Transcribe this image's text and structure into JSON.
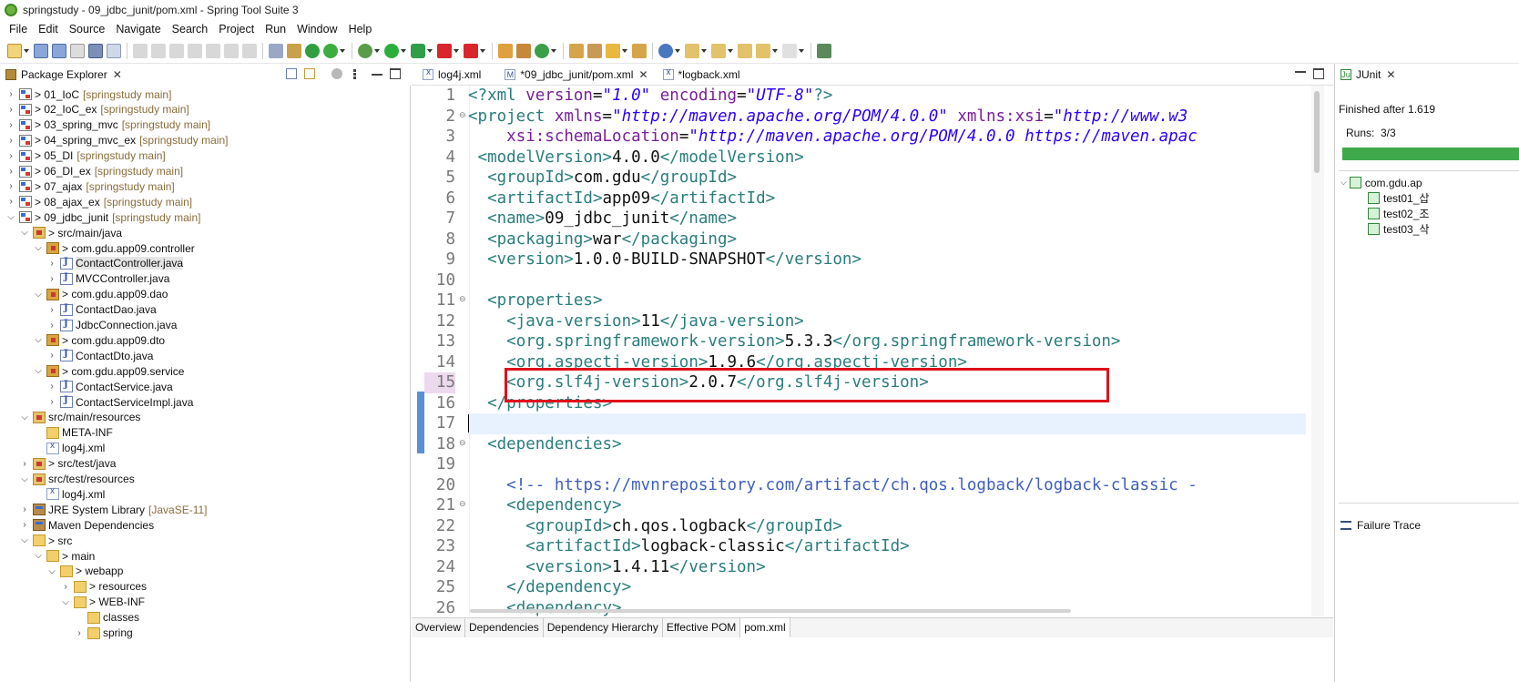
{
  "window": {
    "title": "springstudy - 09_jdbc_junit/pom.xml - Spring Tool Suite 3"
  },
  "menu": [
    "File",
    "Edit",
    "Source",
    "Navigate",
    "Search",
    "Project",
    "Run",
    "Window",
    "Help"
  ],
  "package_explorer": {
    "title": "Package Explorer",
    "tree": [
      {
        "label": "> 01_IoC",
        "decoration": "[springstudy main]",
        "icon": "project-icon"
      },
      {
        "label": "> 02_IoC_ex",
        "decoration": "[springstudy main]",
        "icon": "project-icon"
      },
      {
        "label": "> 03_spring_mvc",
        "decoration": "[springstudy main]",
        "icon": "project-icon"
      },
      {
        "label": "> 04_spring_mvc_ex",
        "decoration": "[springstudy main]",
        "icon": "project-icon"
      },
      {
        "label": "> 05_DI",
        "decoration": "[springstudy main]",
        "icon": "project-icon"
      },
      {
        "label": "> 06_DI_ex",
        "decoration": "[springstudy main]",
        "icon": "project-icon"
      },
      {
        "label": "> 07_ajax",
        "decoration": "[springstudy main]",
        "icon": "project-icon"
      },
      {
        "label": "> 08_ajax_ex",
        "decoration": "[springstudy main]",
        "icon": "project-icon"
      },
      {
        "label": "> 09_jdbc_junit",
        "decoration": "[springstudy main]",
        "icon": "project-icon"
      },
      {
        "label": "> src/main/java",
        "decoration": "",
        "icon": "source-folder-icon"
      },
      {
        "label": "> com.gdu.app09.controller",
        "decoration": "",
        "icon": "package-icon"
      },
      {
        "label": "ContactController.java",
        "decoration": "",
        "icon": "java-file-icon"
      },
      {
        "label": "MVCController.java",
        "decoration": "",
        "icon": "java-file-icon"
      },
      {
        "label": "> com.gdu.app09.dao",
        "decoration": "",
        "icon": "package-icon"
      },
      {
        "label": "ContactDao.java",
        "decoration": "",
        "icon": "java-file-icon"
      },
      {
        "label": "JdbcConnection.java",
        "decoration": "",
        "icon": "java-file-icon"
      },
      {
        "label": "> com.gdu.app09.dto",
        "decoration": "",
        "icon": "package-icon"
      },
      {
        "label": "ContactDto.java",
        "decoration": "",
        "icon": "java-file-icon"
      },
      {
        "label": "> com.gdu.app09.service",
        "decoration": "",
        "icon": "package-icon"
      },
      {
        "label": "ContactService.java",
        "decoration": "",
        "icon": "java-file-icon"
      },
      {
        "label": "ContactServiceImpl.java",
        "decoration": "",
        "icon": "java-file-icon"
      },
      {
        "label": "src/main/resources",
        "decoration": "",
        "icon": "source-folder-icon"
      },
      {
        "label": "META-INF",
        "decoration": "",
        "icon": "folder-icon"
      },
      {
        "label": "log4j.xml",
        "decoration": "",
        "icon": "xml-file-icon"
      },
      {
        "label": "> src/test/java",
        "decoration": "",
        "icon": "source-folder-icon"
      },
      {
        "label": "src/test/resources",
        "decoration": "",
        "icon": "source-folder-icon"
      },
      {
        "label": "log4j.xml",
        "decoration": "",
        "icon": "xml-file-icon"
      },
      {
        "label": "JRE System Library",
        "decoration": "[JavaSE-11]",
        "icon": "library-icon"
      },
      {
        "label": "Maven Dependencies",
        "decoration": "",
        "icon": "library-icon"
      },
      {
        "label": "> src",
        "decoration": "",
        "icon": "folder-icon"
      },
      {
        "label": "> main",
        "decoration": "",
        "icon": "folder-icon"
      },
      {
        "label": "> webapp",
        "decoration": "",
        "icon": "folder-icon"
      },
      {
        "label": "> resources",
        "decoration": "",
        "icon": "folder-icon"
      },
      {
        "label": "> WEB-INF",
        "decoration": "",
        "icon": "folder-icon"
      },
      {
        "label": "classes",
        "decoration": "",
        "icon": "folder-icon"
      },
      {
        "label": "spring",
        "decoration": "",
        "icon": "folder-icon"
      }
    ]
  },
  "editor": {
    "tabs": [
      {
        "label": "log4j.xml"
      },
      {
        "label": "*09_jdbc_junit/pom.xml"
      },
      {
        "label": "*logback.xml"
      }
    ],
    "line_numbers": [
      "1",
      "2",
      "3",
      "4",
      "5",
      "6",
      "7",
      "8",
      "9",
      "10",
      "11",
      "12",
      "13",
      "14",
      "15",
      "16",
      "17",
      "18",
      "19",
      "20",
      "21",
      "22",
      "23",
      "24",
      "25",
      "26"
    ],
    "lines": [
      [
        {
          "t": "tag",
          "s": "<?xml "
        },
        {
          "t": "attr",
          "s": "version"
        },
        {
          "t": "txt",
          "s": "="
        },
        {
          "t": "val",
          "s": "\"1.0\""
        },
        {
          "t": "txt",
          "s": " "
        },
        {
          "t": "attr",
          "s": "encoding"
        },
        {
          "t": "txt",
          "s": "="
        },
        {
          "t": "val",
          "s": "\"UTF-8\""
        },
        {
          "t": "tag",
          "s": "?>"
        }
      ],
      [
        {
          "t": "tag",
          "s": "<project "
        },
        {
          "t": "attr",
          "s": "xmlns"
        },
        {
          "t": "txt",
          "s": "="
        },
        {
          "t": "val",
          "s": "\"http://maven.apache.org/POM/4.0.0\""
        },
        {
          "t": "txt",
          "s": " "
        },
        {
          "t": "attr",
          "s": "xmlns:xsi"
        },
        {
          "t": "txt",
          "s": "="
        },
        {
          "t": "val",
          "s": "\"http://www.w3"
        }
      ],
      [
        {
          "t": "txt",
          "s": "    "
        },
        {
          "t": "attr",
          "s": "xsi:schemaLocation"
        },
        {
          "t": "txt",
          "s": "="
        },
        {
          "t": "val",
          "s": "\"http://maven.apache.org/POM/4.0.0 https://maven.apac"
        }
      ],
      [
        {
          "t": "txt",
          "s": " "
        },
        {
          "t": "tag",
          "s": "<modelVersion>"
        },
        {
          "t": "txt",
          "s": "4.0.0"
        },
        {
          "t": "tag",
          "s": "</modelVersion>"
        }
      ],
      [
        {
          "t": "txt",
          "s": "  "
        },
        {
          "t": "tag",
          "s": "<groupId>"
        },
        {
          "t": "txt",
          "s": "com.gdu"
        },
        {
          "t": "tag",
          "s": "</groupId>"
        }
      ],
      [
        {
          "t": "txt",
          "s": "  "
        },
        {
          "t": "tag",
          "s": "<artifactId>"
        },
        {
          "t": "txt",
          "s": "app09"
        },
        {
          "t": "tag",
          "s": "</artifactId>"
        }
      ],
      [
        {
          "t": "txt",
          "s": "  "
        },
        {
          "t": "tag",
          "s": "<name>"
        },
        {
          "t": "txt",
          "s": "09_jdbc_junit"
        },
        {
          "t": "tag",
          "s": "</name>"
        }
      ],
      [
        {
          "t": "txt",
          "s": "  "
        },
        {
          "t": "tag",
          "s": "<packaging>"
        },
        {
          "t": "txt",
          "s": "war"
        },
        {
          "t": "tag",
          "s": "</packaging>"
        }
      ],
      [
        {
          "t": "txt",
          "s": "  "
        },
        {
          "t": "tag",
          "s": "<version>"
        },
        {
          "t": "txt",
          "s": "1.0.0-BUILD-SNAPSHOT"
        },
        {
          "t": "tag",
          "s": "</version>"
        }
      ],
      [],
      [
        {
          "t": "txt",
          "s": "  "
        },
        {
          "t": "tag",
          "s": "<properties>"
        }
      ],
      [
        {
          "t": "txt",
          "s": "    "
        },
        {
          "t": "tag",
          "s": "<java-version>"
        },
        {
          "t": "txt",
          "s": "11"
        },
        {
          "t": "tag",
          "s": "</java-version>"
        }
      ],
      [
        {
          "t": "txt",
          "s": "    "
        },
        {
          "t": "tag",
          "s": "<org.springframework-version>"
        },
        {
          "t": "txt",
          "s": "5.3.3"
        },
        {
          "t": "tag",
          "s": "</org.springframework-version>"
        }
      ],
      [
        {
          "t": "txt",
          "s": "    "
        },
        {
          "t": "tag",
          "s": "<org.aspectj-version>"
        },
        {
          "t": "txt",
          "s": "1.9.6"
        },
        {
          "t": "tag",
          "s": "</org.aspectj-version>"
        }
      ],
      [
        {
          "t": "txt",
          "s": "    "
        },
        {
          "t": "tag",
          "s": "<org.slf4j-version>"
        },
        {
          "t": "txt",
          "s": "2.0.7"
        },
        {
          "t": "tag",
          "s": "</org.slf4j-version>"
        }
      ],
      [
        {
          "t": "txt",
          "s": "  "
        },
        {
          "t": "tag",
          "s": "</properties>"
        }
      ],
      [],
      [
        {
          "t": "txt",
          "s": "  "
        },
        {
          "t": "tag",
          "s": "<dependencies>"
        }
      ],
      [],
      [
        {
          "t": "txt",
          "s": "    "
        },
        {
          "t": "cmt",
          "s": "<!-- https://mvnrepository.com/artifact/ch.qos.logback/logback-classic -"
        }
      ],
      [
        {
          "t": "txt",
          "s": "    "
        },
        {
          "t": "tag",
          "s": "<dependency>"
        }
      ],
      [
        {
          "t": "txt",
          "s": "      "
        },
        {
          "t": "tag",
          "s": "<groupId>"
        },
        {
          "t": "txt",
          "s": "ch.qos.logback"
        },
        {
          "t": "tag",
          "s": "</groupId>"
        }
      ],
      [
        {
          "t": "txt",
          "s": "      "
        },
        {
          "t": "tag",
          "s": "<artifactId>"
        },
        {
          "t": "txt",
          "s": "logback-classic"
        },
        {
          "t": "tag",
          "s": "</artifactId>"
        }
      ],
      [
        {
          "t": "txt",
          "s": "      "
        },
        {
          "t": "tag",
          "s": "<version>"
        },
        {
          "t": "txt",
          "s": "1.4.11"
        },
        {
          "t": "tag",
          "s": "</version>"
        }
      ],
      [
        {
          "t": "txt",
          "s": "    "
        },
        {
          "t": "tag",
          "s": "</dependency>"
        }
      ],
      [
        {
          "t": "txt",
          "s": "    "
        },
        {
          "t": "tag",
          "s": "<dependency>"
        }
      ]
    ],
    "bottom_tabs": [
      "Overview",
      "Dependencies",
      "Dependency Hierarchy",
      "Effective POM",
      "pom.xml"
    ]
  },
  "junit": {
    "title": "JUnit",
    "status": "Finished after 1.619",
    "runs_label": "Runs:",
    "runs_value": "3/3",
    "suite": "com.gdu.ap",
    "tests": [
      "test01_삽",
      "test02_조",
      "test03_삭"
    ],
    "failure_trace": "Failure Trace"
  },
  "colors": {
    "tag": "#2a7d7d",
    "attribute": "#7a1e9a",
    "string": "#2a00ff",
    "comment": "#3f5fbf",
    "highlight_box": "#e0101a",
    "junit_success": "#3fa84a",
    "current_line": "#e8f2fe"
  }
}
